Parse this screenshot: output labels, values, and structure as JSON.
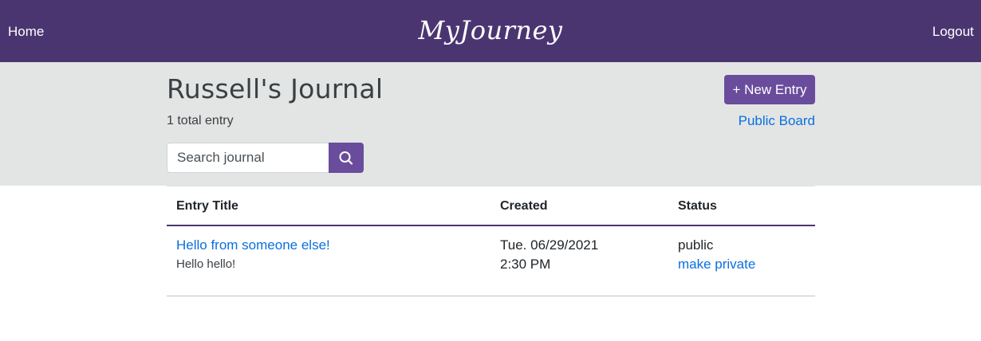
{
  "nav": {
    "home_label": "Home",
    "brand": "MyJourney",
    "logout_label": "Logout"
  },
  "journal": {
    "title": "Russell's Journal",
    "entry_count": "1 total entry",
    "new_entry_label": "+ New Entry",
    "public_board_label": "Public Board"
  },
  "search": {
    "placeholder": "Search journal",
    "value": "",
    "icon": "search-icon"
  },
  "table": {
    "columns": [
      "Entry Title",
      "Created",
      "Status"
    ],
    "rows": [
      {
        "title": "Hello from someone else!",
        "preview": "Hello hello!",
        "created_date": "Tue. 06/29/2021",
        "created_time": "2:30 PM",
        "status": "public",
        "status_action": "make private"
      }
    ]
  },
  "colors": {
    "nav_bg": "#4b3571",
    "accent_button": "#6a4c9c",
    "header_band": "#e3e5e4",
    "link": "#0a6fe0"
  }
}
